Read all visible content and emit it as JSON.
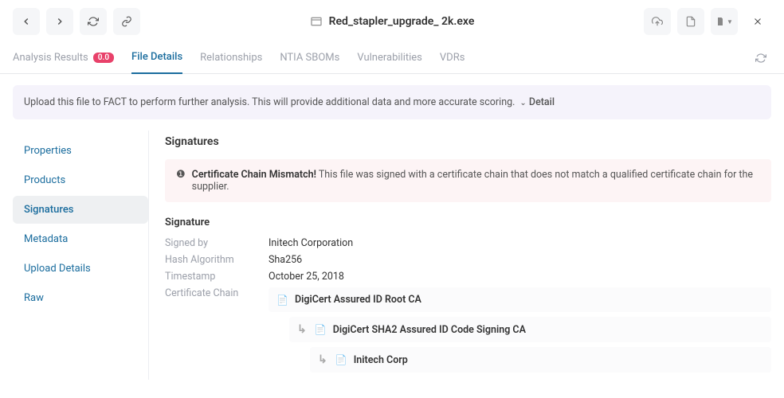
{
  "header": {
    "title": "Red_stapler_upgrade_ 2k.exe"
  },
  "tabs": {
    "analysis_results": "Analysis Results",
    "analysis_badge": "0.0",
    "file_details": "File Details",
    "relationships": "Relationships",
    "ntia_sboms": "NTIA SBOMs",
    "vulnerabilities": "Vulnerabilities",
    "vdrs": "VDRs"
  },
  "banner": {
    "text": "Upload this file to FACT to perform further analysis. This will provide additional data and more accurate scoring.",
    "detail": "Detail"
  },
  "sidebar": {
    "properties": "Properties",
    "products": "Products",
    "signatures": "Signatures",
    "metadata": "Metadata",
    "upload_details": "Upload Details",
    "raw": "Raw"
  },
  "main": {
    "section_title": "Signatures",
    "alert_strong": "Certificate Chain Mismatch!",
    "alert_text": " This file was signed with a certificate chain that does not match a qualified certificate chain for the supplier.",
    "signature_heading": "Signature",
    "labels": {
      "signed_by": "Signed by",
      "hash_algorithm": "Hash Algorithm",
      "timestamp": "Timestamp",
      "certificate_chain": "Certificate Chain"
    },
    "values": {
      "signed_by": "Initech Corporation",
      "hash_algorithm": "Sha256",
      "timestamp": "October 25, 2018"
    },
    "chain": {
      "root": "DigiCert Assured ID Root CA",
      "mid": "DigiCert SHA2 Assured ID Code Signing CA",
      "leaf": "Initech Corp"
    }
  }
}
